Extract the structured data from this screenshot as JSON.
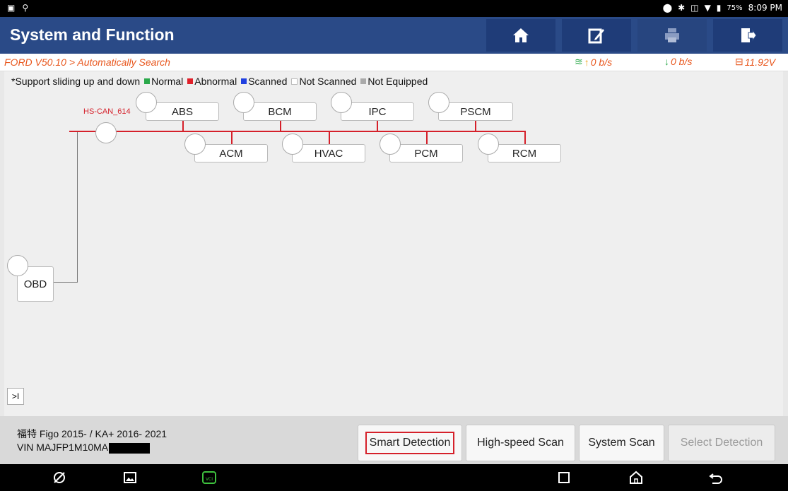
{
  "statusbar": {
    "battery": "75%",
    "time": "8:09 PM"
  },
  "header": {
    "title": "System and Function",
    "icons": [
      "home-icon",
      "edit-icon",
      "print-icon",
      "exit-icon"
    ]
  },
  "subbar": {
    "breadcrumb": "FORD V50.10 > Automatically Search",
    "upload_rate": "0 b/s",
    "download_rate": "0 b/s",
    "voltage": "11.92V"
  },
  "legend": {
    "hint": "*Support sliding up and down",
    "normal": "Normal",
    "abnormal": "Abnormal",
    "scanned": "Scanned",
    "not_scanned": "Not Scanned",
    "not_equipped": "Not Equipped",
    "colors": {
      "normal": "#2aa84a",
      "abnormal": "#e0202a",
      "scanned": "#2040e0",
      "not_scanned": "#ffffff",
      "not_equipped": "#aaaaaa"
    }
  },
  "topology": {
    "bus_label": "HS-CAN_614",
    "obd": "OBD",
    "modules_top": [
      "ABS",
      "BCM",
      "IPC",
      "PSCM"
    ],
    "modules_bottom": [
      "ACM",
      "HVAC",
      "PCM",
      "RCM"
    ],
    "expand_label": ">I"
  },
  "vehicle": {
    "model": "福特 Figo 2015- / KA+ 2016- 2021",
    "vin": "VIN MAJFP1M10MA"
  },
  "buttons": {
    "smart": "Smart Detection",
    "highspeed": "High-speed Scan",
    "system": "System Scan",
    "select": "Select Detection"
  },
  "colors": {
    "header": "#2a4a87",
    "accent": "#e8561c",
    "bus_line": "#d5202a",
    "highlight_border": "#d5202a"
  }
}
